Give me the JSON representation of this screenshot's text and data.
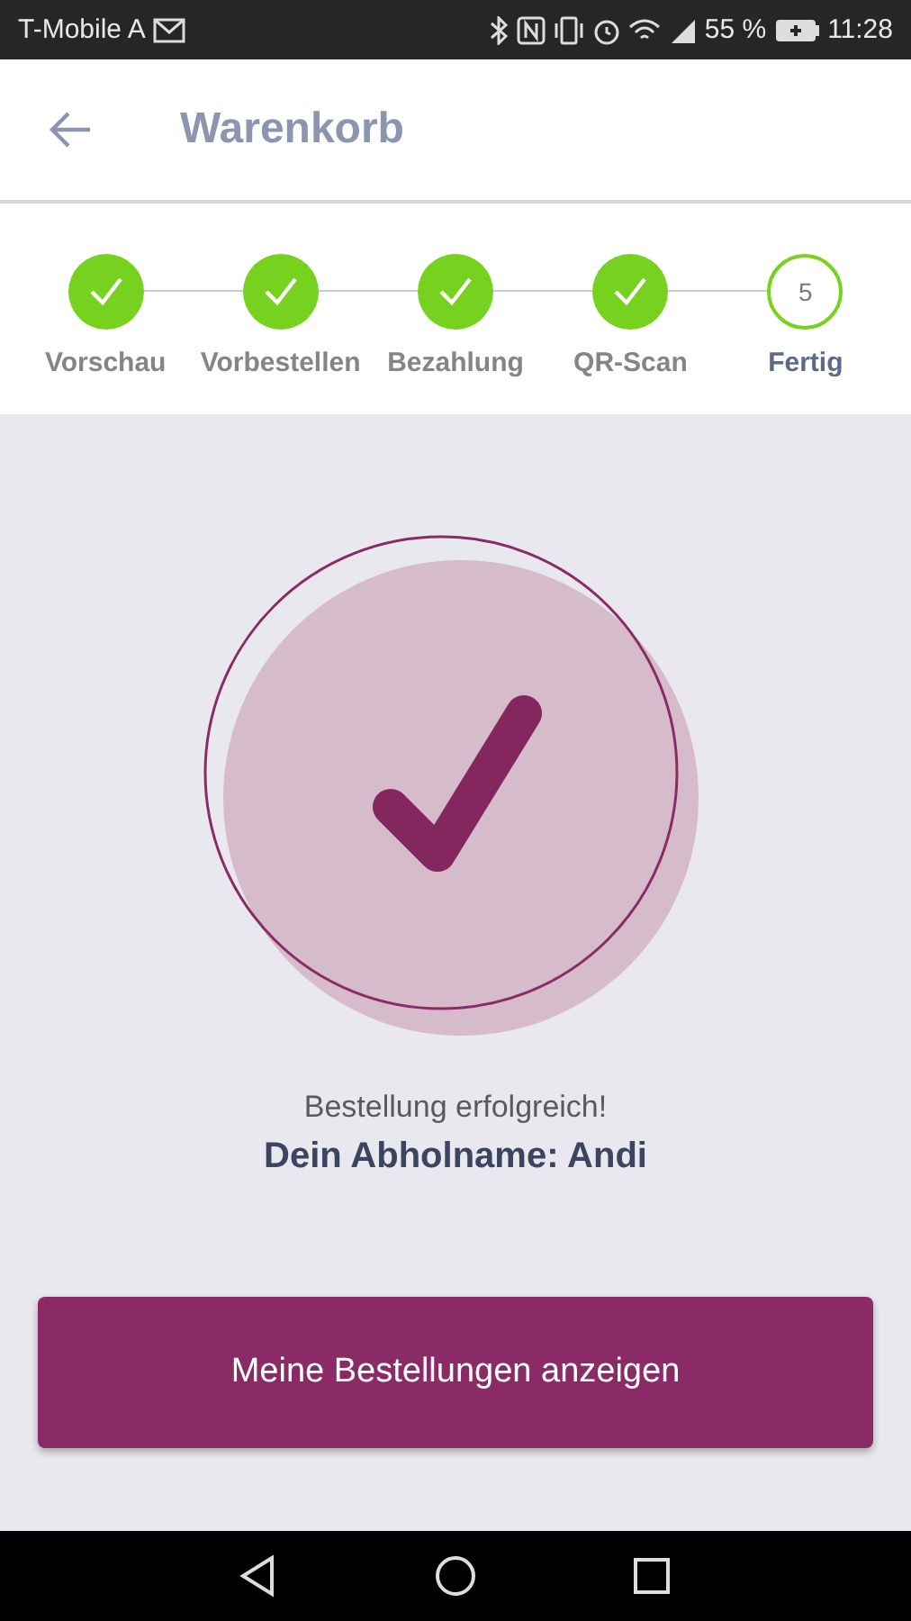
{
  "status_bar": {
    "carrier": "T-Mobile A",
    "battery_percent": "55 %",
    "time": "11:28"
  },
  "app_bar": {
    "title": "Warenkorb"
  },
  "steps": [
    {
      "label": "Vorschau",
      "done": true,
      "selected": false
    },
    {
      "label": "Vorbestellen",
      "done": true,
      "selected": false
    },
    {
      "label": "Bezahlung",
      "done": true,
      "selected": false
    },
    {
      "label": "QR-Scan",
      "done": true,
      "selected": false
    },
    {
      "label": "Fertig",
      "number": "5",
      "done": false,
      "selected": true
    }
  ],
  "success": {
    "message": "Bestellung erfolgreich!",
    "pickup_name": "Dein Abholname: Andi"
  },
  "button": {
    "label": "Meine Bestellungen anzeigen"
  }
}
